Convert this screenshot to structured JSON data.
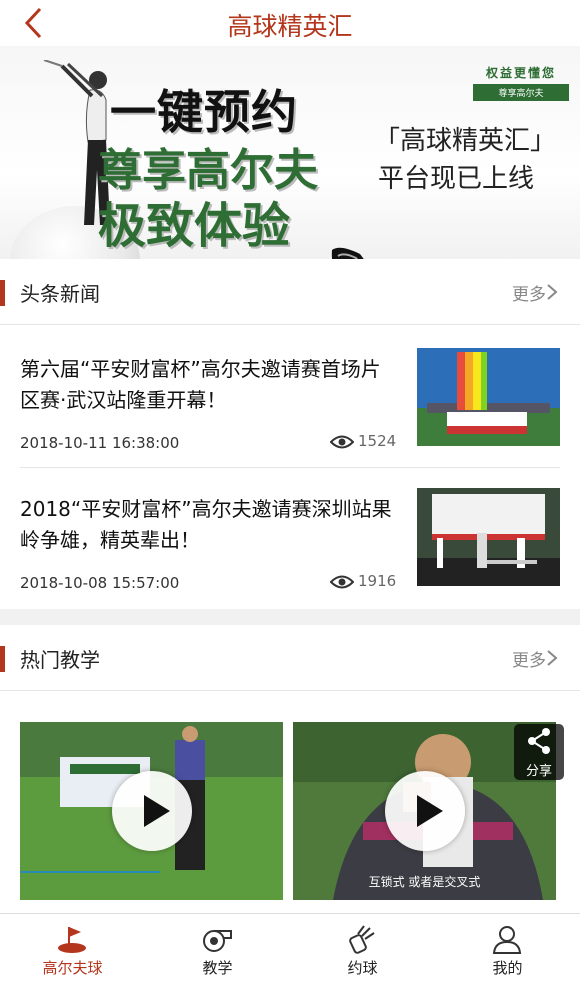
{
  "header": {
    "title": "高球精英汇"
  },
  "banner": {
    "line1": "一键预约",
    "line2": "尊享高尔夫",
    "line3": "极致体验",
    "right_line1": "「高球精英汇」",
    "right_line2": "平台现已上线",
    "logo_top": "权益更懂您",
    "logo_bottom": "尊享高尔夫"
  },
  "news": {
    "title": "头条新闻",
    "more": "更多",
    "items": [
      {
        "title": "第六届“平安财富杯”高尔夫邀请赛首场片区赛·武汉站隆重开幕！",
        "date": "2018-10-11 16:38:00",
        "views": "1524"
      },
      {
        "title": "2018“平安财富杯”高尔夫邀请赛深圳站果岭争雄，精英辈出！",
        "date": "2018-10-08 15:57:00",
        "views": "1916"
      }
    ]
  },
  "teaching": {
    "title": "热门教学",
    "more": "更多",
    "share": "分享",
    "videos": [
      {
        "caption": ""
      },
      {
        "caption": "互锁式 或者是交叉式"
      }
    ]
  },
  "tabs": [
    {
      "label": "高尔夫球",
      "icon": "golf-flag-icon",
      "active": true
    },
    {
      "label": "教学",
      "icon": "whistle-icon",
      "active": false
    },
    {
      "label": "约球",
      "icon": "golf-bag-icon",
      "active": false
    },
    {
      "label": "我的",
      "icon": "user-icon",
      "active": false
    }
  ],
  "colors": {
    "accent": "#b3361d",
    "banner_green": "#2e6e34"
  }
}
